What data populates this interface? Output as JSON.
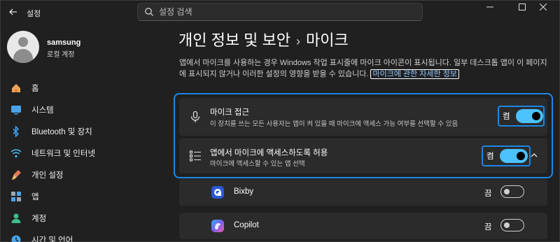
{
  "app": {
    "title": "설정"
  },
  "search": {
    "placeholder": "설정 검색"
  },
  "profile": {
    "name": "samsung",
    "account_type": "로컬 계정"
  },
  "sidebar": {
    "items": [
      {
        "label": "홈",
        "icon": "home-icon"
      },
      {
        "label": "시스템",
        "icon": "system-icon"
      },
      {
        "label": "Bluetooth 및 장치",
        "icon": "bluetooth-icon"
      },
      {
        "label": "네트워크 및 인터넷",
        "icon": "wifi-icon"
      },
      {
        "label": "개인 설정",
        "icon": "brush-icon"
      },
      {
        "label": "앱",
        "icon": "apps-icon"
      },
      {
        "label": "계정",
        "icon": "account-icon"
      },
      {
        "label": "시간 및 언어",
        "icon": "time-language-icon"
      }
    ]
  },
  "breadcrumb": {
    "parent": "개인 정보 및 보안",
    "separator": "›",
    "current": "마이크"
  },
  "description": {
    "text": "앱에서 마이크를 사용하는 경우 Windows 작업 표시줄에 마이크 아이콘이 표시됩니다. 일부 데스크톱 앱이 이 페이지에 표시되지 않거나 이러한 설정의 영향을 받을 수 있습니다.",
    "link": "마이크에 관한 자세한 정보"
  },
  "settings": {
    "mic_access": {
      "title": "마이크 접근",
      "subtitle": "이 장치를 쓰는 모든 사용자는 앱이 켜 있을 때 마이크에 액세스 가능 여부를 선택할 수 있음",
      "state_label": "켬",
      "on": true
    },
    "app_access": {
      "title": "앱에서 마이크에 액세스하도록 허용",
      "subtitle": "마이크에 액세스할 수 있는 앱 선택",
      "state_label": "켬",
      "on": true
    }
  },
  "apps": [
    {
      "name": "Bixby",
      "state_label": "끔",
      "on": false
    },
    {
      "name": "Copilot",
      "state_label": "끔",
      "on": false
    }
  ],
  "colors": {
    "accent": "#4cc2ff",
    "highlight_border": "#1b87e6",
    "background": "#202020",
    "card": "#2b2b2b"
  }
}
